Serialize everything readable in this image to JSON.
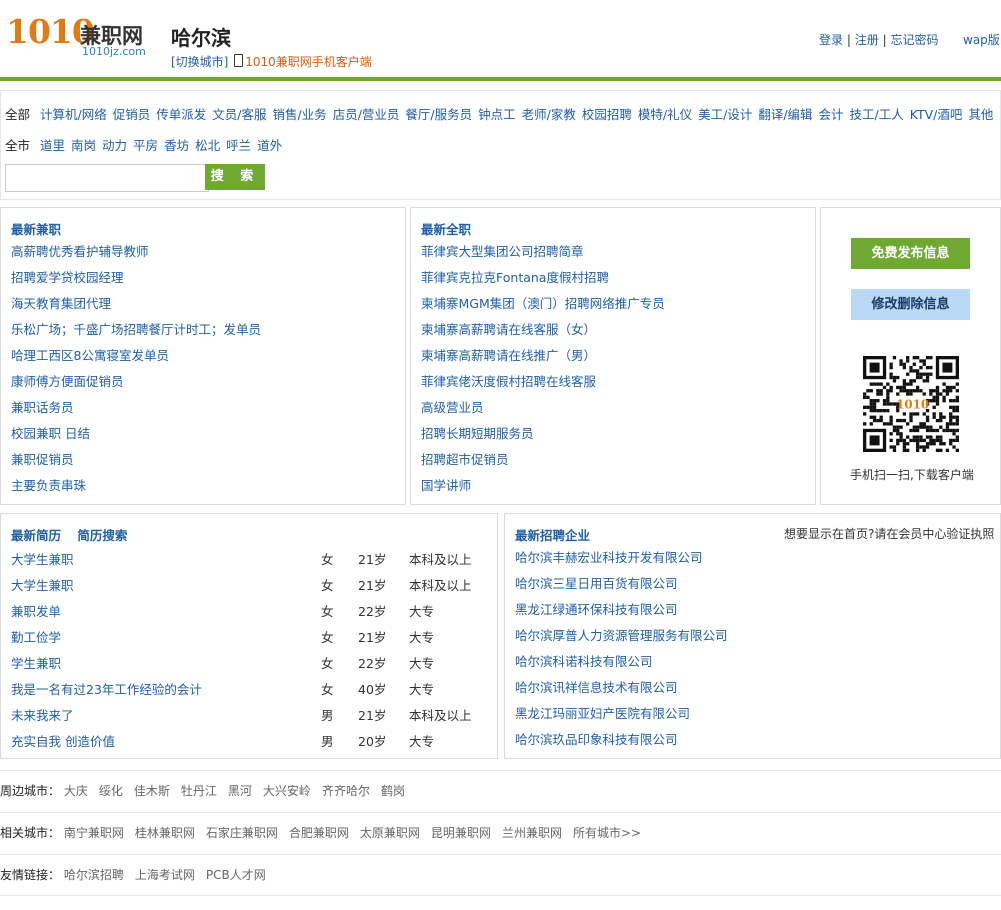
{
  "header": {
    "logo_num": "1010",
    "logo_cn": "兼职网",
    "logo_domain": "1010jz.com",
    "city": "哈尔滨",
    "switch_city": "[切换城市]",
    "app_link": "1010兼职网手机客户端",
    "login": "登录",
    "register": "注册",
    "forgot": "忘记密码",
    "wap": "wap版",
    "sep": "|"
  },
  "filters": {
    "all_label": "全部",
    "categories": [
      "计算机/网络",
      "促销员",
      "传单派发",
      "文员/客服",
      "销售/业务",
      "店员/营业员",
      "餐厅/服务员",
      "钟点工",
      "老师/家教",
      "校园招聘",
      "模特/礼仪",
      "美工/设计",
      "翻译/编辑",
      "会计",
      "技工/工人",
      "KTV/酒吧",
      "其他"
    ],
    "city_all_label": "全市",
    "districts": [
      "道里",
      "南岗",
      "动力",
      "平房",
      "香坊",
      "松北",
      "呼兰",
      "道外"
    ],
    "search_placeholder": "",
    "search_button": "搜 索"
  },
  "parttime": {
    "title": "最新兼职",
    "items": [
      "高薪聘优秀看护辅导教师",
      "招聘爱学贷校园经理",
      "海天教育集团代理",
      "乐松广场；千盛广场招聘餐厅计时工；发单员",
      "哈理工西区8公寓寝室发单员",
      "康师傅方便面促销员",
      "兼职话务员",
      "校园兼职 日结",
      "兼职促销员",
      "主要负责串珠"
    ]
  },
  "fulltime": {
    "title": "最新全职",
    "items": [
      "菲律宾大型集团公司招聘简章",
      "菲律宾克拉克Fontana度假村招聘",
      "柬埔寨MGM集团（澳门）招聘网络推广专员",
      "柬埔寨高薪聘请在线客服（女）",
      "柬埔寨高薪聘请在线推广（男）",
      "菲律宾佬沃度假村招聘在线客服",
      "高级营业员",
      "招聘长期短期服务员",
      "招聘超市促销员",
      "国学讲师"
    ]
  },
  "side": {
    "publish": "免费发布信息",
    "modify": "修改删除信息",
    "qr_caption": "手机扫一扫,下载客户端",
    "qr_label": "1010"
  },
  "resumes": {
    "title": "最新简历",
    "search": "简历搜索",
    "rows": [
      {
        "name": "大学生兼职",
        "gender": "女",
        "age": "21岁",
        "edu": "本科及以上"
      },
      {
        "name": "大学生兼职",
        "gender": "女",
        "age": "21岁",
        "edu": "本科及以上"
      },
      {
        "name": "兼职发单",
        "gender": "女",
        "age": "22岁",
        "edu": "大专"
      },
      {
        "name": "勤工俭学",
        "gender": "女",
        "age": "21岁",
        "edu": "大专"
      },
      {
        "name": "学生兼职",
        "gender": "女",
        "age": "22岁",
        "edu": "大专"
      },
      {
        "name": "我是一名有过23年工作经验的会计",
        "gender": "女",
        "age": "40岁",
        "edu": "大专"
      },
      {
        "name": "未来我来了",
        "gender": "男",
        "age": "21岁",
        "edu": "本科及以上"
      },
      {
        "name": "充实自我 创造价值",
        "gender": "男",
        "age": "20岁",
        "edu": "大专"
      }
    ]
  },
  "companies": {
    "title": "最新招聘企业",
    "note": "想要显示在首页?请在会员中心验证执照",
    "items": [
      "哈尔滨丰赫宏业科技开发有限公司",
      "哈尔滨三星日用百货有限公司",
      "黑龙江绿通环保科技有限公司",
      "哈尔滨厚普人力资源管理服务有限公司",
      "哈尔滨科诺科技有限公司",
      "哈尔滨讯祥信息技术有限公司",
      "黑龙江玛丽亚妇产医院有限公司",
      "哈尔滨玖品印象科技有限公司"
    ]
  },
  "footer": {
    "nearby_label": "周边城市：",
    "nearby": [
      "大庆",
      "绥化",
      "佳木斯",
      "牡丹江",
      "黑河",
      "大兴安岭",
      "齐齐哈尔",
      "鹤岗"
    ],
    "related_label": "相关城市：",
    "related": [
      "南宁兼职网",
      "桂林兼职网",
      "石家庄兼职网",
      "合肥兼职网",
      "太原兼职网",
      "昆明兼职网",
      "兰州兼职网",
      "所有城市>>"
    ],
    "friends_label": "友情链接：",
    "friends": [
      "哈尔滨招聘",
      "上海考试网",
      "PCB人才网"
    ]
  },
  "colors": {
    "green": "#6fa931",
    "link": "#1f5fa8",
    "orange": "#e05a00",
    "light_blue": "#b9d9f7"
  }
}
